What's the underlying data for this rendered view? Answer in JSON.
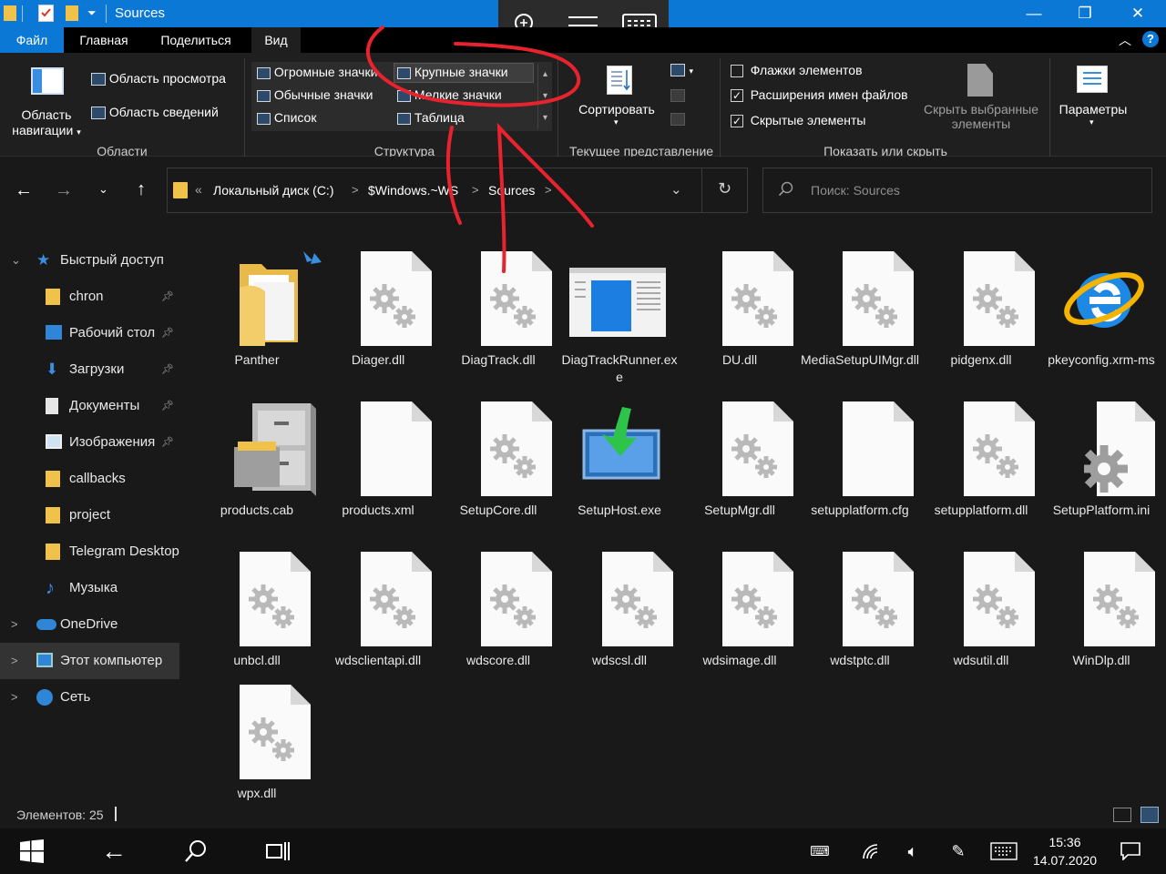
{
  "window": {
    "title": "Sources",
    "minimize": "—",
    "maximize": "❐",
    "close": "✕"
  },
  "ribbon_tabs": [
    "Файл",
    "Главная",
    "Поделиться",
    "Вид"
  ],
  "ribbon": {
    "nav_pane": [
      "Область",
      "навигации"
    ],
    "preview_pane": "Область просмотра",
    "details_pane": "Область сведений",
    "group_panes": "Области",
    "layouts": [
      "Огромные значки",
      "Крупные значки",
      "Обычные значки",
      "Мелкие значки",
      "Список",
      "Таблица"
    ],
    "group_layout": "Структура",
    "sort": "Сортировать",
    "group_current_view": "Текущее представление",
    "checks": [
      {
        "label": "Флажки элементов",
        "checked": false
      },
      {
        "label": "Расширения имен файлов",
        "checked": true
      },
      {
        "label": "Скрытые элементы",
        "checked": true
      }
    ],
    "hide_selected": [
      "Скрыть выбранные",
      "элементы"
    ],
    "group_show_hide": "Показать или скрыть",
    "options": "Параметры"
  },
  "address": {
    "prefix": "«",
    "crumbs": [
      "Локальный диск (C:)",
      "$Windows.~WS",
      "Sources"
    ],
    "separator": ">",
    "search_placeholder": "Поиск: Sources"
  },
  "nav": {
    "items": [
      {
        "label": "Быстрый доступ",
        "icon": "star-icon",
        "pinned": false,
        "indent": 0,
        "chevron": "⌄"
      },
      {
        "label": "chron",
        "icon": "folder-icon",
        "pinned": true,
        "indent": 1
      },
      {
        "label": "Рабочий стол",
        "icon": "desktop-icon",
        "pinned": true,
        "indent": 1
      },
      {
        "label": "Загрузки",
        "icon": "download-icon",
        "pinned": true,
        "indent": 1
      },
      {
        "label": "Документы",
        "icon": "document-icon",
        "pinned": true,
        "indent": 1
      },
      {
        "label": "Изображения",
        "icon": "pictures-icon",
        "pinned": true,
        "indent": 1
      },
      {
        "label": "callbacks",
        "icon": "folder-icon",
        "pinned": false,
        "indent": 1
      },
      {
        "label": "project",
        "icon": "folder-icon",
        "pinned": false,
        "indent": 1
      },
      {
        "label": "Telegram Desktop",
        "icon": "folder-icon",
        "pinned": false,
        "indent": 1
      },
      {
        "label": "Музыка",
        "icon": "music-icon",
        "pinned": false,
        "indent": 1
      },
      {
        "label": "OneDrive",
        "icon": "cloud-icon",
        "pinned": false,
        "indent": 0,
        "chevron": ">"
      },
      {
        "label": "Этот компьютер",
        "icon": "computer-icon",
        "pinned": false,
        "indent": 0,
        "chevron": ">",
        "selected": true
      },
      {
        "label": "Сеть",
        "icon": "network-icon",
        "pinned": false,
        "indent": 0,
        "chevron": ">"
      }
    ]
  },
  "files": [
    {
      "name": "Panther",
      "icon": "folder-icon"
    },
    {
      "name": "Diager.dll",
      "icon": "gear-file-icon"
    },
    {
      "name": "DiagTrack.dll",
      "icon": "gear-file-icon"
    },
    {
      "name": "DiagTrackRunner.exe",
      "icon": "app-window-icon"
    },
    {
      "name": "DU.dll",
      "icon": "gear-file-icon"
    },
    {
      "name": "MediaSetupUIMgr.dll",
      "icon": "gear-file-icon"
    },
    {
      "name": "pidgenx.dll",
      "icon": "gear-file-icon"
    },
    {
      "name": "pkeyconfig.xrm-ms",
      "icon": "internet-explorer-icon"
    },
    {
      "name": "products.cab",
      "icon": "cabinet-icon"
    },
    {
      "name": "products.xml",
      "icon": "blank-file-icon"
    },
    {
      "name": "SetupCore.dll",
      "icon": "gear-file-icon"
    },
    {
      "name": "SetupHost.exe",
      "icon": "setup-installer-icon"
    },
    {
      "name": "SetupMgr.dll",
      "icon": "gear-file-icon"
    },
    {
      "name": "setupplatform.cfg",
      "icon": "blank-file-icon"
    },
    {
      "name": "setupplatform.dll",
      "icon": "gear-file-icon"
    },
    {
      "name": "SetupPlatform.ini",
      "icon": "gear-settings-file-icon"
    },
    {
      "name": "unbcl.dll",
      "icon": "gear-file-icon"
    },
    {
      "name": "wdsclientapi.dll",
      "icon": "gear-file-icon"
    },
    {
      "name": "wdscore.dll",
      "icon": "gear-file-icon"
    },
    {
      "name": "wdscsl.dll",
      "icon": "gear-file-icon"
    },
    {
      "name": "wdsimage.dll",
      "icon": "gear-file-icon"
    },
    {
      "name": "wdstptc.dll",
      "icon": "gear-file-icon"
    },
    {
      "name": "wdsutil.dll",
      "icon": "gear-file-icon"
    },
    {
      "name": "WinDlp.dll",
      "icon": "gear-file-icon"
    },
    {
      "name": "wpx.dll",
      "icon": "gear-file-icon"
    }
  ],
  "status": {
    "count": "Элементов: 25"
  },
  "taskbar": {
    "time": "15:36",
    "date": "14.07.2020"
  },
  "colors": {
    "accent": "#0c78d5",
    "background": "#191919",
    "ribbon": "#1f1f1f",
    "annotation": "#e8232e"
  }
}
